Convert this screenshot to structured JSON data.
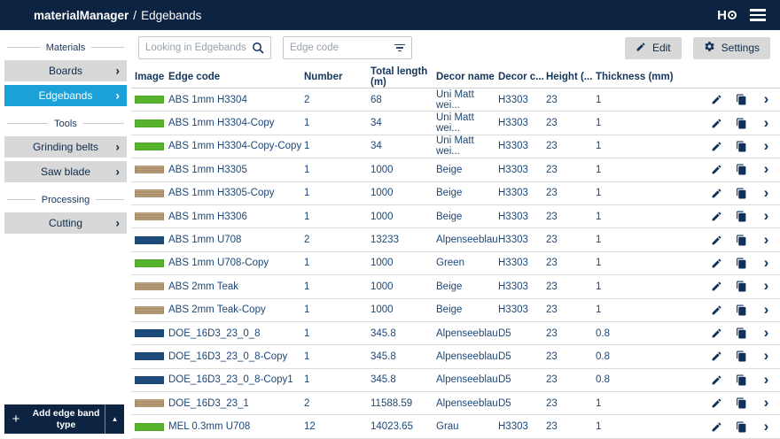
{
  "header": {
    "brand": "materialManager",
    "separator": "/",
    "page": "Edgebands",
    "logo_text": "H"
  },
  "sidebar": {
    "sections": [
      {
        "label": "Materials",
        "items": [
          {
            "label": "Boards",
            "active": false
          },
          {
            "label": "Edgebands",
            "active": true
          }
        ]
      },
      {
        "label": "Tools",
        "items": [
          {
            "label": "Grinding belts",
            "active": false
          },
          {
            "label": "Saw blade",
            "active": false
          }
        ]
      },
      {
        "label": "Processing",
        "items": [
          {
            "label": "Cutting",
            "active": false
          }
        ]
      }
    ],
    "add_button": {
      "label": "Add edge band type"
    }
  },
  "toolbar": {
    "search_placeholder": "Looking in Edgebands",
    "filter_placeholder": "Edge code",
    "edit_label": "Edit",
    "settings_label": "Settings"
  },
  "table": {
    "columns": [
      "Image",
      "Edge code",
      "Number",
      "Total length (m)",
      "Decor name",
      "Decor c...",
      "Height (...",
      "Thickness (mm)"
    ],
    "rows": [
      {
        "swatch": "green",
        "edge_code": "ABS 1mm H3304",
        "number": "2",
        "total_length": "68",
        "decor_name": "Uni Matt wei...",
        "decor_code": "H3303",
        "height": "23",
        "thickness": "1"
      },
      {
        "swatch": "green",
        "edge_code": "ABS 1mm H3304-Copy",
        "number": "1",
        "total_length": "34",
        "decor_name": "Uni Matt wei...",
        "decor_code": "H3303",
        "height": "23",
        "thickness": "1"
      },
      {
        "swatch": "green",
        "edge_code": "ABS 1mm H3304-Copy-Copy",
        "number": "1",
        "total_length": "34",
        "decor_name": "Uni Matt wei...",
        "decor_code": "H3303",
        "height": "23",
        "thickness": "1"
      },
      {
        "swatch": "tan",
        "edge_code": "ABS 1mm H3305",
        "number": "1",
        "total_length": "1000",
        "decor_name": "Beige",
        "decor_code": "H3303",
        "height": "23",
        "thickness": "1"
      },
      {
        "swatch": "tan",
        "edge_code": "ABS 1mm H3305-Copy",
        "number": "1",
        "total_length": "1000",
        "decor_name": "Beige",
        "decor_code": "H3303",
        "height": "23",
        "thickness": "1"
      },
      {
        "swatch": "tan",
        "edge_code": "ABS 1mm H3306",
        "number": "1",
        "total_length": "1000",
        "decor_name": "Beige",
        "decor_code": "H3303",
        "height": "23",
        "thickness": "1"
      },
      {
        "swatch": "blue",
        "edge_code": "ABS 1mm U708",
        "number": "2",
        "total_length": "13233",
        "decor_name": "Alpenseeblau",
        "decor_code": "H3303",
        "height": "23",
        "thickness": "1"
      },
      {
        "swatch": "green",
        "edge_code": "ABS 1mm U708-Copy",
        "number": "1",
        "total_length": "1000",
        "decor_name": "Green",
        "decor_code": "H3303",
        "height": "23",
        "thickness": "1"
      },
      {
        "swatch": "tan",
        "edge_code": "ABS 2mm Teak",
        "number": "1",
        "total_length": "1000",
        "decor_name": "Beige",
        "decor_code": "H3303",
        "height": "23",
        "thickness": "1"
      },
      {
        "swatch": "tan",
        "edge_code": "ABS 2mm Teak-Copy",
        "number": "1",
        "total_length": "1000",
        "decor_name": "Beige",
        "decor_code": "H3303",
        "height": "23",
        "thickness": "1"
      },
      {
        "swatch": "blue",
        "edge_code": "DOE_16D3_23_0_8",
        "number": "1",
        "total_length": "345.8",
        "decor_name": "Alpenseeblau",
        "decor_code": "D5",
        "height": "23",
        "thickness": "0.8"
      },
      {
        "swatch": "blue",
        "edge_code": "DOE_16D3_23_0_8-Copy",
        "number": "1",
        "total_length": "345.8",
        "decor_name": "Alpenseeblau",
        "decor_code": "D5",
        "height": "23",
        "thickness": "0.8"
      },
      {
        "swatch": "blue",
        "edge_code": "DOE_16D3_23_0_8-Copy1",
        "number": "1",
        "total_length": "345.8",
        "decor_name": "Alpenseeblau",
        "decor_code": "D5",
        "height": "23",
        "thickness": "0.8"
      },
      {
        "swatch": "tan",
        "edge_code": "DOE_16D3_23_1",
        "number": "2",
        "total_length": "11588.59",
        "decor_name": "Alpenseeblau",
        "decor_code": "D5",
        "height": "23",
        "thickness": "1"
      },
      {
        "swatch": "green",
        "edge_code": "MEL 0.3mm U708",
        "number": "12",
        "total_length": "14023.65",
        "decor_name": "Grau",
        "decor_code": "H3303",
        "height": "23",
        "thickness": "1"
      }
    ]
  },
  "colors": {
    "topbar_bg": "#0c2342",
    "active_item": "#1ba1d8",
    "button_gray": "#d8d8d8",
    "text_navy": "#1c4878",
    "heading_navy": "#14365c",
    "swatch_green": "#57b32c",
    "swatch_blue": "#1d4c7b",
    "swatch_tan": "#b39872",
    "row_border": "#dcdcdc"
  }
}
